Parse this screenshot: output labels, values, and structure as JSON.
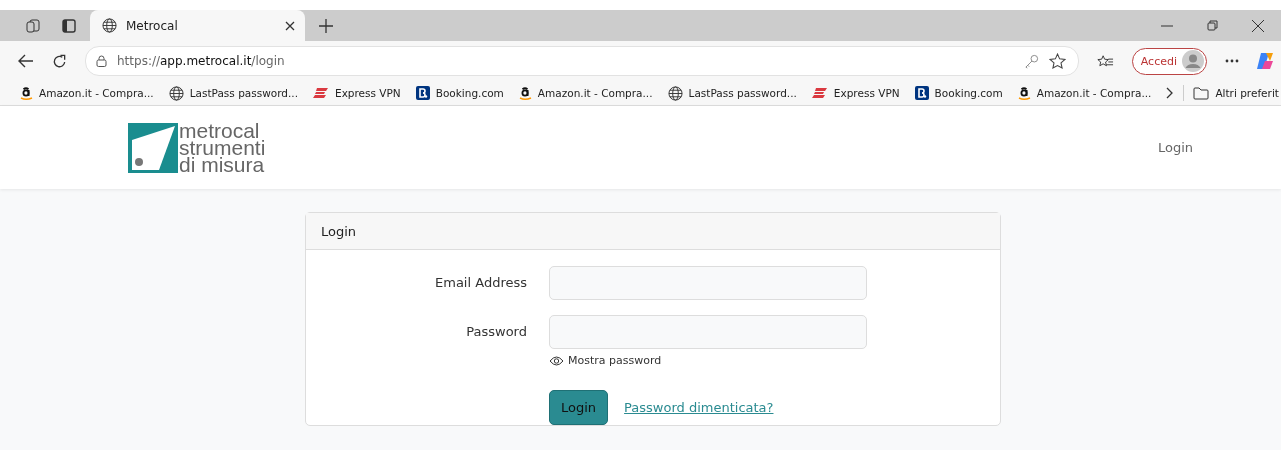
{
  "browser": {
    "tab": {
      "title": "Metrocal"
    },
    "url": {
      "scheme": "https://",
      "host": "app.metrocal.it",
      "path": "/login"
    },
    "sign_in": "Accedi",
    "bookmarks": [
      {
        "kind": "amazon",
        "label": "Amazon.it - Compra..."
      },
      {
        "kind": "globe",
        "label": "LastPass password..."
      },
      {
        "kind": "vpn",
        "label": "Express VPN"
      },
      {
        "kind": "booking",
        "label": "Booking.com"
      },
      {
        "kind": "amazon",
        "label": "Amazon.it - Compra..."
      },
      {
        "kind": "globe",
        "label": "LastPass password..."
      },
      {
        "kind": "vpn",
        "label": "Express VPN"
      },
      {
        "kind": "booking",
        "label": "Booking.com"
      },
      {
        "kind": "amazon",
        "label": "Amazon.it - Compra..."
      }
    ],
    "other_bookmarks": "Altri preferit"
  },
  "header": {
    "logo": [
      "metrocal",
      "strumenti",
      "di misura"
    ],
    "nav_link": "Login"
  },
  "card": {
    "title": "Login",
    "fields": [
      {
        "label": "Email Address",
        "kind": "email"
      },
      {
        "label": "Password",
        "kind": "password"
      }
    ],
    "show_password": "Mostra password",
    "submit": "Login",
    "forgot": "Password dimenticata?"
  }
}
